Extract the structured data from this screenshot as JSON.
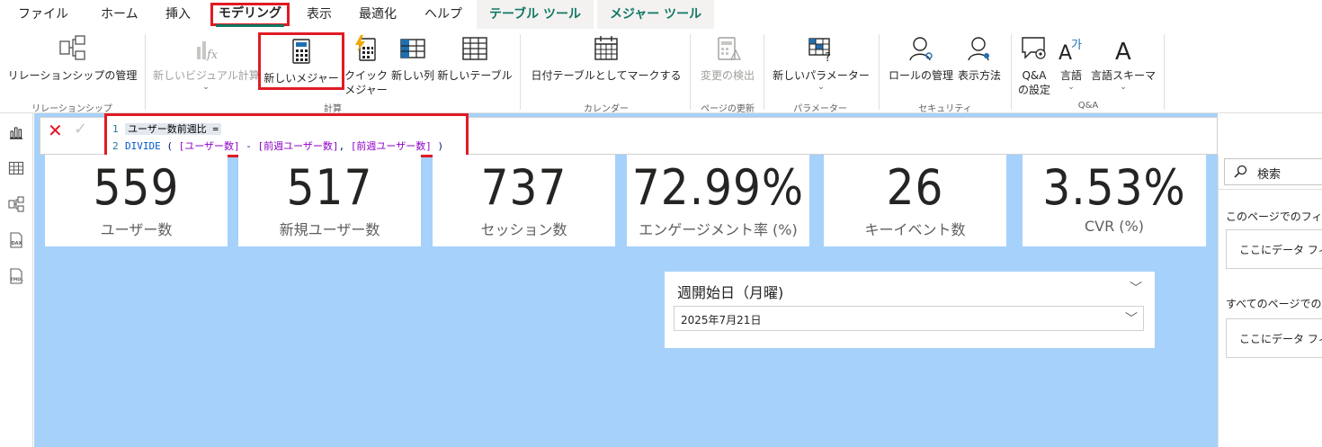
{
  "menu": {
    "tabs": [
      "ファイル",
      "ホーム",
      "挿入",
      "モデリング",
      "表示",
      "最適化",
      "ヘルプ"
    ],
    "context_tabs": [
      "テーブル ツール",
      "メジャー ツール"
    ]
  },
  "ribbon": {
    "buttons": {
      "relationship": "リレーションシップの管理",
      "new_visual_calc": "新しいビジュアル計算",
      "new_measure": "新しいメジャー",
      "quick_measure_1": "クイック",
      "quick_measure_2": "メジャー",
      "new_column": "新しい列",
      "new_table": "新しいテーブル",
      "mark_date_table": "日付テーブルとしてマークする",
      "change_detect": "変更の検出",
      "new_parameter": "新しいパラメーター",
      "manage_roles": "ロールの管理",
      "view_as": "表示方法",
      "qa_setup_1": "Q&A",
      "qa_setup_2": "の設定",
      "language": "言語",
      "linguistic_schema": "言語スキーマ"
    },
    "groups": {
      "relationship": "リレーションシップ",
      "calculation": "計算",
      "calendar": "カレンダー",
      "page_refresh": "ページの更新",
      "parameter": "パラメーター",
      "security": "セキュリティ",
      "qa": "Q&A"
    }
  },
  "formula": {
    "line1_num": "1",
    "line1_text": "ユーザー数前週比 =",
    "line2_num": "2",
    "fn": "DIVIDE",
    "open": " ( ",
    "ref1": "[ユーザー数]",
    "minus": " - ",
    "ref2": "[前週ユーザー数]",
    "comma": ", ",
    "ref3": "[前週ユーザー数]",
    "close": " )"
  },
  "cards": [
    {
      "value": "559",
      "label": "ユーザー数"
    },
    {
      "value": "517",
      "label": "新規ユーザー数"
    },
    {
      "value": "737",
      "label": "セッション数"
    },
    {
      "value": "72.99%",
      "label": "エンゲージメント率 (%)"
    },
    {
      "value": "26",
      "label": "キーイベント数"
    },
    {
      "value": "3.53%",
      "label": "CVR (%)"
    }
  ],
  "slicer": {
    "title": "週開始日（月曜)",
    "selected": "2025年7月21日"
  },
  "filter_pane": {
    "search_placeholder": "検索",
    "this_page_header": "このページでのフィ",
    "this_page_drop": "ここにデータ フィ",
    "all_pages_header": "すべてのページでの",
    "all_pages_drop": "ここにデータ フィ"
  },
  "colors": {
    "canvas": "#a6d1fb",
    "highlight": "#e01b24",
    "accent": "#117865"
  }
}
